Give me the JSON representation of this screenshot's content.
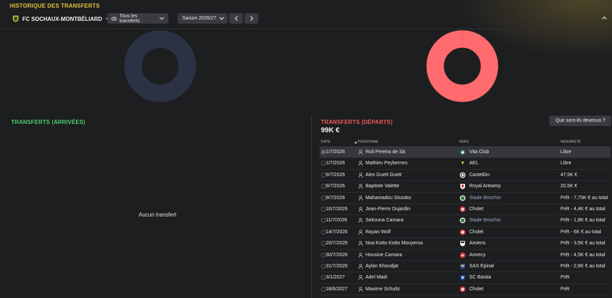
{
  "header": {
    "title": "HISTORIQUE DES TRANSFERTS",
    "club": "FC SOCHAUX-MONTBÉLIARD",
    "filter": "Tous les transferts",
    "season": "Saison 2026/27"
  },
  "colors": {
    "title": "#e2c23c",
    "arrivals": "#4fd16a",
    "departures": "#f05b5b",
    "donut_empty": "#2b3244",
    "donut_departures": "#ff6b6e"
  },
  "arrivals": {
    "title": "TRANSFERTS (ARRIVÉES)",
    "empty": "Aucun transfert"
  },
  "departures": {
    "title": "TRANSFERTS (DÉPARTS)",
    "total": "99K €",
    "fate_button": "Que sont-ils devenus ?",
    "columns": {
      "date": "DATE",
      "person": "PERSONNE",
      "to": "VERS",
      "fee": "INDEMNITÉ"
    },
    "rows": [
      {
        "date": "1/7/2026",
        "person": "Roli Pereira de Sá",
        "club": "Vita Club",
        "fee": "Libre",
        "badge": "vita-club-crest",
        "muted": false
      },
      {
        "date": "1/7/2026",
        "person": "Mathieu Peybernes",
        "club": "AEL",
        "fee": "Libre",
        "badge": "ael-crest",
        "muted": false
      },
      {
        "date": "9/7/2026",
        "person": "Alex Guett Guett",
        "club": "Castellón",
        "fee": "47,5K €",
        "badge": "castellon-crest",
        "muted": false
      },
      {
        "date": "9/7/2026",
        "person": "Baptiste Valette",
        "club": "Royal Antwerp",
        "fee": "20,5K €",
        "badge": "royal-antwerp-crest",
        "muted": false
      },
      {
        "date": "9/7/2026",
        "person": "Mahamadou Sissoko",
        "club": "Stade Briochin",
        "fee": "Prêt - 7,75K € au total",
        "badge": "stade-briochin-crest",
        "muted": true
      },
      {
        "date": "10/7/2026",
        "person": "Jean-Pierre Dujardin",
        "club": "Cholet",
        "fee": "Prêt - 4,4K € au total",
        "badge": "cholet-crest",
        "muted": false
      },
      {
        "date": "11/7/2026",
        "person": "Sekouna Camara",
        "club": "Stade Briochin",
        "fee": "Prêt - 1,8K € au total",
        "badge": "stade-briochin-crest",
        "muted": true
      },
      {
        "date": "14/7/2026",
        "person": "Rayan Wolf",
        "club": "Cholet",
        "fee": "Prêt - 6K € au total",
        "badge": "cholet-crest",
        "muted": false
      },
      {
        "date": "20/7/2026",
        "person": "Noa Kotto Kotto Mouyema",
        "club": "Amiens",
        "fee": "Prêt - 3,5K € au total",
        "badge": "amiens-crest",
        "muted": false
      },
      {
        "date": "30/7/2026",
        "person": "Housine Camara",
        "club": "Annecy",
        "fee": "Prêt - 4,5K € au total",
        "badge": "annecy-crest",
        "muted": false
      },
      {
        "date": "31/7/2026",
        "person": "Aylan Khoudjat",
        "club": "SAS Epinal",
        "fee": "Prêt - 2,6K € au total",
        "badge": "sas-epinal-crest",
        "muted": false
      },
      {
        "date": "3/1/2027",
        "person": "Adel Madi",
        "club": "SC Bastia",
        "fee": "Prêt",
        "badge": "sc-bastia-crest",
        "muted": false
      },
      {
        "date": "18/6/2027",
        "person": "Maxime Schultz",
        "club": "Cholet",
        "fee": "Prêt",
        "badge": "cholet-crest",
        "muted": false
      }
    ]
  }
}
